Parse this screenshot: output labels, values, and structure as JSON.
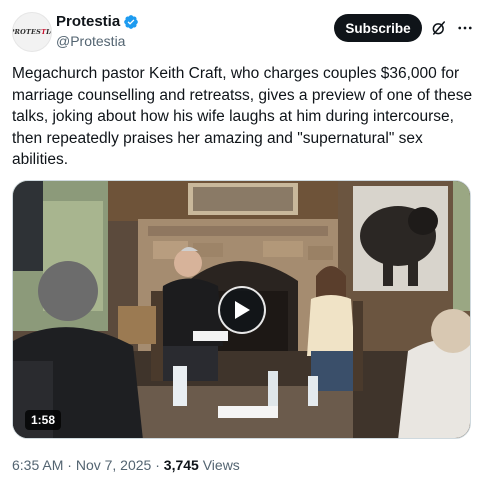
{
  "account": {
    "display_name": "Protestia",
    "handle": "@Protestia",
    "avatar_logo_text": "PROTESTIA",
    "verified": true
  },
  "actions": {
    "subscribe_label": "Subscribe",
    "grok_icon": "grok-icon",
    "more_icon": "more-icon"
  },
  "post": {
    "text": "Megachurch pastor Keith Craft, who charges couples $36,000 for marriage counselling and retreatss, gives a preview of one of these talks, joking about how his wife laughs at him during intercourse, then repeatedly praises her amazing and \"supernatural\" sex abilities."
  },
  "media": {
    "duration": "1:58",
    "play_icon": "play-icon"
  },
  "meta": {
    "time": "6:35 AM",
    "separator1": " · ",
    "date": "Nov 7, 2025",
    "separator2": " · ",
    "views_count": "3,745",
    "views_label": " Views"
  },
  "colors": {
    "verified_blue": "#1d9bf0",
    "text_primary": "#0f1419",
    "text_secondary": "#536471",
    "button_dark": "#0f1419"
  }
}
